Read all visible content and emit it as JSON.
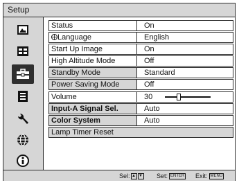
{
  "title": "Setup",
  "sidebar_icons": [
    {
      "name": "picture-icon",
      "selected": false
    },
    {
      "name": "screen-icon",
      "selected": false
    },
    {
      "name": "setup-toolbox-icon",
      "selected": true
    },
    {
      "name": "menu-list-icon",
      "selected": false
    },
    {
      "name": "wrench-icon",
      "selected": false
    },
    {
      "name": "globe-icon",
      "selected": false
    },
    {
      "name": "info-icon",
      "selected": false
    }
  ],
  "rows": [
    {
      "label": "Status",
      "value": "On"
    },
    {
      "label": "Language",
      "value": "English",
      "icon": "language-icon"
    },
    {
      "label": "Start Up Image",
      "value": "On"
    },
    {
      "label": "High Altitude Mode",
      "value": "Off"
    },
    {
      "label": "Standby Mode",
      "value": "Standard"
    },
    {
      "label": "Power Saving Mode",
      "value": "Off"
    },
    {
      "label": "Volume",
      "value": "30",
      "slider_level": 0.3
    },
    {
      "label": "Input-A Signal Sel.",
      "value": "Auto"
    },
    {
      "label": "Color System",
      "value": "Auto"
    },
    {
      "label": "Lamp Timer Reset",
      "value": ""
    }
  ],
  "footer": {
    "sel_label": "Sel:",
    "up_key": "▲",
    "down_key": "▼",
    "set_label": "Set:",
    "set_key": "ENTER",
    "exit_label": "Exit:",
    "exit_key": "MENU"
  }
}
